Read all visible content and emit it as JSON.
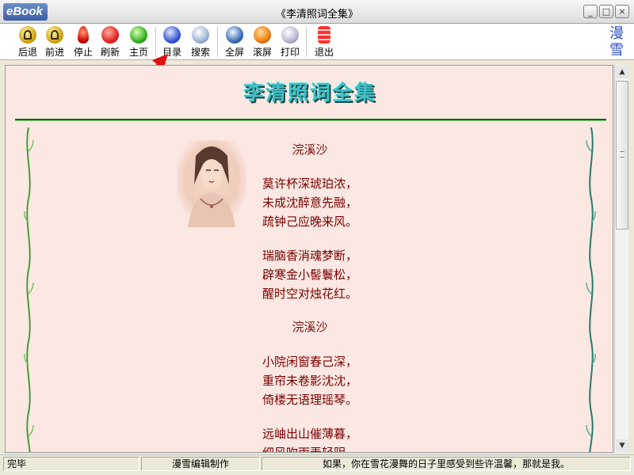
{
  "window": {
    "app_logo": "eBook",
    "title": "《李清照词全集》",
    "min_glyph": "_",
    "max_glyph": "□",
    "close_glyph": "×"
  },
  "toolbar": {
    "items": [
      {
        "label": "后退",
        "icon": "back-icon"
      },
      {
        "label": "前进",
        "icon": "forward-icon"
      },
      {
        "label": "停止",
        "icon": "stop-icon"
      },
      {
        "label": "刷新",
        "icon": "refresh-icon"
      },
      {
        "label": "主页",
        "icon": "home-icon"
      },
      {
        "label": "目录",
        "icon": "directory-icon"
      },
      {
        "label": "搜索",
        "icon": "search-icon"
      },
      {
        "label": "全屏",
        "icon": "fullscreen-icon"
      },
      {
        "label": "滚屏",
        "icon": "autoscroll-icon"
      },
      {
        "label": "打印",
        "icon": "print-icon"
      },
      {
        "label": "退出",
        "icon": "exit-icon"
      }
    ],
    "brand_mark": "漫雪"
  },
  "content": {
    "page_title": "李清照词全集",
    "poems": [
      {
        "title": "浣溪沙",
        "stanzas": [
          [
            "莫许杯深琥珀浓，",
            "未成沈醉意先融，",
            "疏钟己应晚来风。"
          ],
          [
            "瑞脑香消魂梦断，",
            "辟寒金小髻鬟松，",
            "醒时空对烛花红。"
          ]
        ]
      },
      {
        "title": "浣溪沙",
        "stanzas": [
          [
            "小院闲窗春己深，",
            "重帘未卷影沈沈，",
            "倚楼无语理瑶琴。"
          ],
          [
            "远岫出山催薄暮，",
            "细风吹雨弄轻阴，"
          ]
        ]
      }
    ]
  },
  "statusbar": {
    "state": "完毕",
    "author": "漫雪编辑制作",
    "message": "如果，你在雪花漫舞的日子里感受到些许温馨，那就是我。"
  },
  "colors": {
    "poem_text": "#7a0000",
    "page_bg": "#fbe8e2",
    "title_cyan": "#40c0c8",
    "rule_green": "#0a6a0a"
  }
}
